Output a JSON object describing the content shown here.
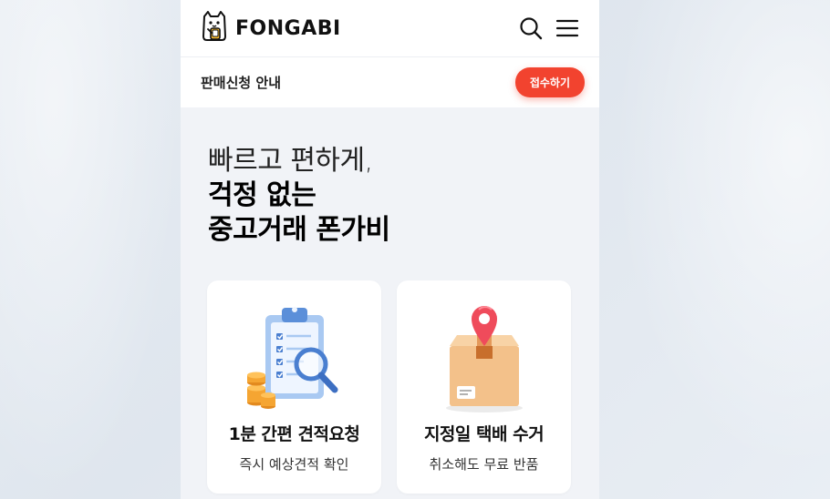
{
  "brand": {
    "name": "FONGABI"
  },
  "notice": {
    "title": "판매신청 안내",
    "apply_label": "접수하기"
  },
  "hero": {
    "line1": "빠르고 편하게,",
    "line2": "걱정 없는",
    "line3": "중고거래 폰가비"
  },
  "cards": [
    {
      "title": "1분 간편 견적요청",
      "subtitle": "즉시 예상견적 확인",
      "icon": "clipboard-magnifier-icon"
    },
    {
      "title": "지정일 택배 수거",
      "subtitle": "취소해도 무료 반품",
      "icon": "parcel-box-pin-icon"
    }
  ],
  "colors": {
    "accent": "#f2432f",
    "page_bg": "#f1f3f7",
    "card_bg": "#ffffff"
  }
}
